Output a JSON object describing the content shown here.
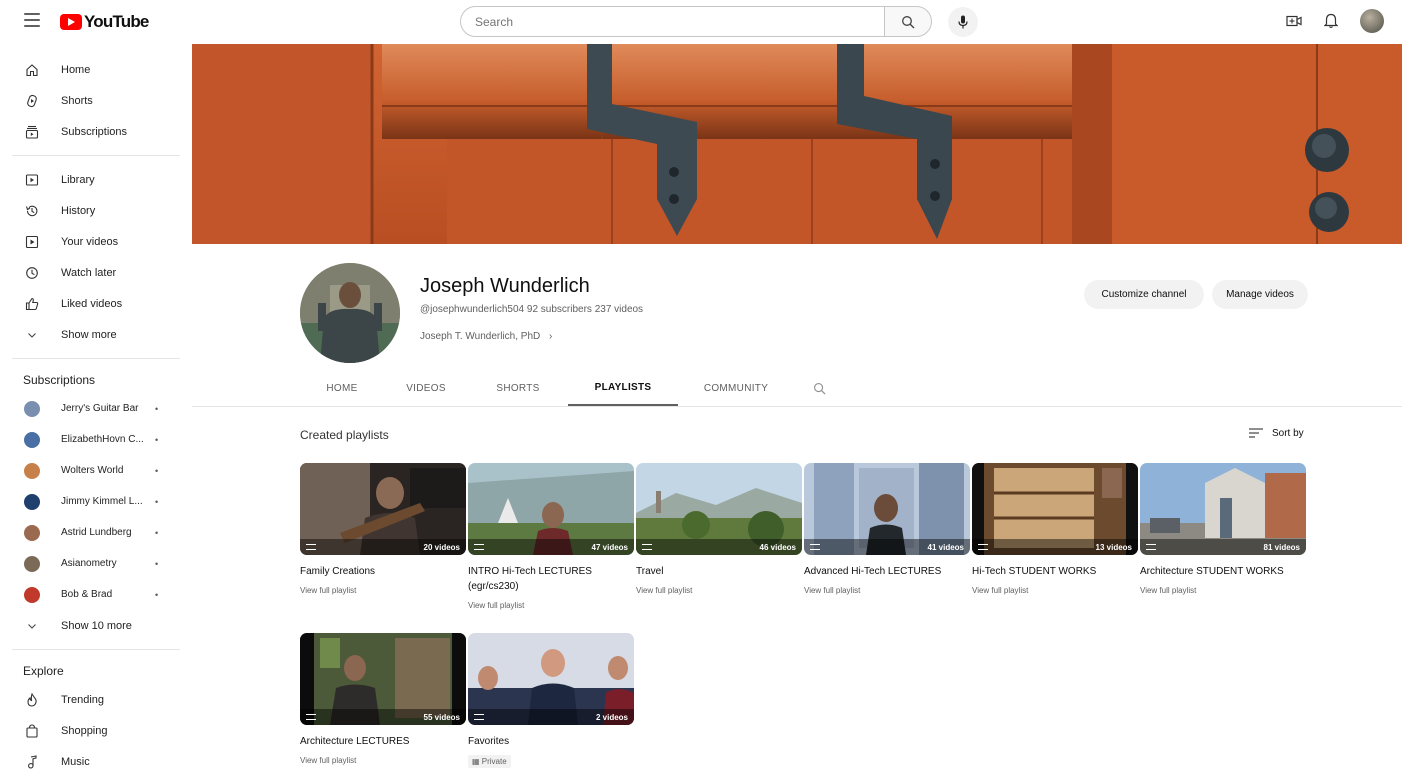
{
  "topbar": {
    "logo_text": "YouTube",
    "search_placeholder": "Search"
  },
  "sidebar": {
    "main": [
      {
        "label": "Home",
        "icon": "home-icon"
      },
      {
        "label": "Shorts",
        "icon": "shorts-icon"
      },
      {
        "label": "Subscriptions",
        "icon": "subscriptions-icon"
      }
    ],
    "library": [
      {
        "label": "Library",
        "icon": "library-icon"
      },
      {
        "label": "History",
        "icon": "history-icon"
      },
      {
        "label": "Your videos",
        "icon": "your-videos-icon"
      },
      {
        "label": "Watch later",
        "icon": "watch-later-icon"
      },
      {
        "label": "Liked videos",
        "icon": "thumbs-up-icon"
      },
      {
        "label": "Show more",
        "icon": "chevron-down-icon"
      }
    ],
    "subscriptions_title": "Subscriptions",
    "subscriptions": [
      {
        "label": "Jerry's Guitar Bar",
        "color": "#7a8fb0"
      },
      {
        "label": "ElizabethHovn C...",
        "color": "#4a6fa5"
      },
      {
        "label": "Wolters World",
        "color": "#c8804a"
      },
      {
        "label": "Jimmy Kimmel L...",
        "color": "#1f3f6e"
      },
      {
        "label": "Astrid Lundberg",
        "color": "#9a6a50"
      },
      {
        "label": "Asianometry",
        "color": "#7b6a58"
      },
      {
        "label": "Bob & Brad",
        "color": "#c0392b"
      }
    ],
    "show_more_subs": "Show 10 more",
    "explore_title": "Explore",
    "explore": [
      {
        "label": "Trending",
        "icon": "trending-icon"
      },
      {
        "label": "Shopping",
        "icon": "shopping-icon"
      },
      {
        "label": "Music",
        "icon": "music-icon"
      }
    ]
  },
  "channel": {
    "name": "Joseph Wunderlich",
    "meta": "@josephwunderlich504  92 subscribers  237 videos",
    "link": "Joseph T. Wunderlich, PhD",
    "customize_label": "Customize channel",
    "manage_label": "Manage videos"
  },
  "tabs": [
    {
      "label": "HOME"
    },
    {
      "label": "VIDEOS"
    },
    {
      "label": "SHORTS"
    },
    {
      "label": "PLAYLISTS",
      "active": true
    },
    {
      "label": "COMMUNITY"
    }
  ],
  "playlists_section": {
    "title": "Created playlists",
    "sort_label": "Sort by"
  },
  "playlists": [
    {
      "title": "Family Creations",
      "count": "20 videos",
      "action": "View full playlist"
    },
    {
      "title": "INTRO Hi-Tech LECTURES (egr/cs230)",
      "count": "47 videos",
      "action": "View full playlist"
    },
    {
      "title": "Travel",
      "count": "46 videos",
      "action": "View full playlist"
    },
    {
      "title": "Advanced Hi-Tech LECTURES",
      "count": "41 videos",
      "action": "View full playlist"
    },
    {
      "title": "Hi-Tech STUDENT WORKS",
      "count": "13 videos",
      "action": "View full playlist"
    },
    {
      "title": "Architecture STUDENT WORKS",
      "count": "81 videos",
      "action": "View full playlist"
    },
    {
      "title": "Architecture LECTURES",
      "count": "55 videos",
      "action": "View full playlist"
    },
    {
      "title": "Favorites",
      "count": "2 videos",
      "action": "Private"
    }
  ]
}
